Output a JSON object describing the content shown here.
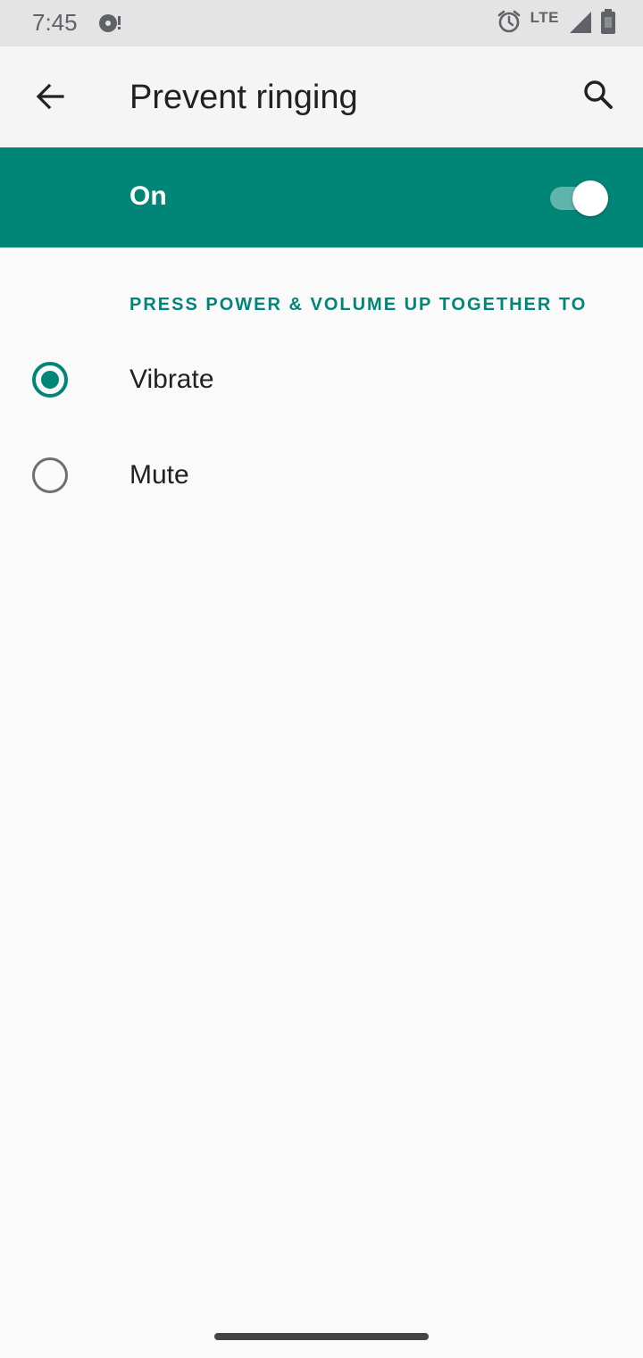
{
  "status_bar": {
    "time": "7:45",
    "left_icons": [
      "sync-icon"
    ],
    "network_label": "LTE",
    "right_icons": [
      "alarm-icon",
      "signal-icon",
      "battery-icon"
    ]
  },
  "app_bar": {
    "title": "Prevent ringing",
    "back_icon": "arrow-back-icon",
    "search_icon": "search-icon"
  },
  "master_switch": {
    "label": "On",
    "checked": true,
    "background_color": "#008577"
  },
  "section": {
    "header": "PRESS POWER & VOLUME UP TOGETHER TO"
  },
  "options": [
    {
      "label": "Vibrate",
      "selected": true
    },
    {
      "label": "Mute",
      "selected": false
    }
  ],
  "colors": {
    "accent": "#008577",
    "background": "#fafafa"
  }
}
